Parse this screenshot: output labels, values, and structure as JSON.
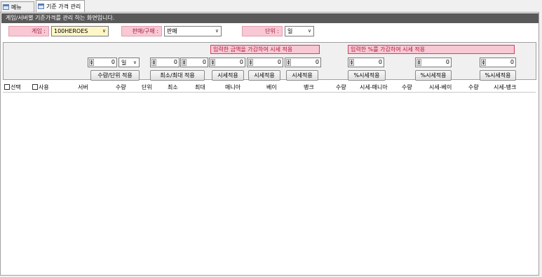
{
  "tabs": [
    {
      "label": "메뉴",
      "icon": "window-icon",
      "active": false
    },
    {
      "label": "기준 가격 관리",
      "icon": "window-icon",
      "active": true
    }
  ],
  "header": {
    "description": "게임/서버별 기준가격를 관리 하는 화면입니다."
  },
  "filters": {
    "game_label": "게임 :",
    "game_value": "100HEROES",
    "trade_label": "판매/구매 :",
    "trade_value": "판매",
    "unit_label": "단위 :",
    "unit_value": "일"
  },
  "panel": {
    "amount_section_title": "입력한 금액을 가감하여 시세 적용",
    "percent_section_title": "입력한 %를 가감하여 시세 적용",
    "qty_value": "0",
    "unit_select": "일",
    "qty_unit_button": "수량/단위 적용",
    "min_value": "0",
    "max_value": "0",
    "minmax_button": "최소/최대 적용",
    "amount_values": [
      "0",
      "0",
      "0"
    ],
    "amount_buttons": [
      "시세적용",
      "시세적용",
      "시세적용"
    ],
    "percent_values": [
      "0",
      "0",
      "0"
    ],
    "percent_buttons": [
      "%시세적용",
      "%시세적용",
      "%시세적용"
    ]
  },
  "grid": {
    "select_label": "선택",
    "use_label": "사용",
    "columns": [
      "서버",
      "수량",
      "단위",
      "최소",
      "최대",
      "매니아",
      "베이",
      "뱅크",
      "수량",
      "시세-매니아",
      "수량",
      "시세-베이",
      "수량",
      "시세-뱅크"
    ]
  },
  "colors": {
    "title_bar": "#595959",
    "pink_label": "#f8c8d4",
    "game_select_bg": "#fff6c8"
  }
}
